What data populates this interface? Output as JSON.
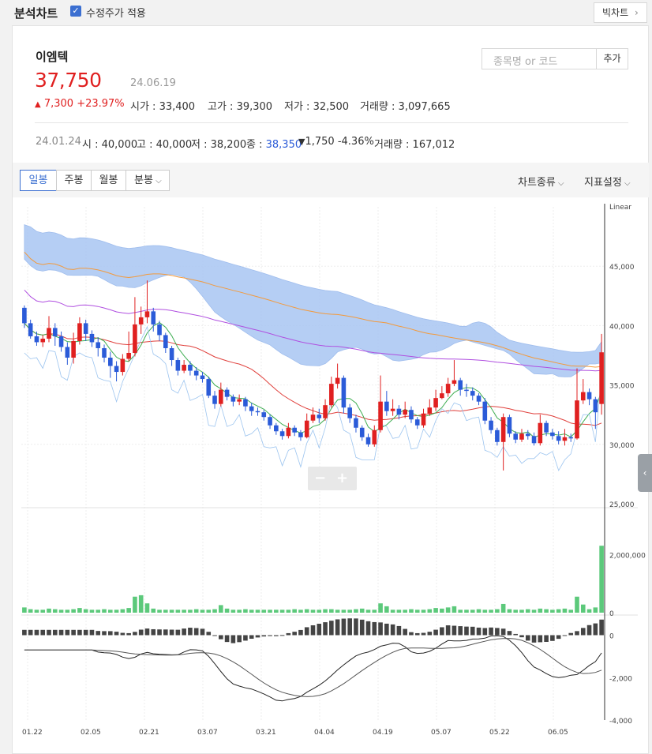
{
  "header": {
    "title": "분석차트",
    "adjusted_label": "수정주가 적용",
    "big_chart_label": "빅차트"
  },
  "stock": {
    "name": "이엠텍",
    "price": "37,750",
    "date": "24.06.19",
    "change": "7,300",
    "change_pct": "+23.97%",
    "open_label": "시가",
    "open": "33,400",
    "high_label": "고가",
    "high": "39,300",
    "low_label": "저가",
    "low": "32,500",
    "volume_label": "거래량",
    "volume": "3,097,665"
  },
  "prev": {
    "date": "24.01.24",
    "open_label": "시",
    "open": "40,000",
    "high_label": "고",
    "high": "40,000",
    "low_label": "저",
    "low": "38,200",
    "close_label": "종",
    "close": "38,350",
    "change": "1,750",
    "change_pct": "-4.36%",
    "volume_label": "거래량",
    "volume": "167,012"
  },
  "search": {
    "placeholder": "종목명 or 코드",
    "add_label": "추가"
  },
  "tabs": [
    {
      "label": "일봉",
      "active": true
    },
    {
      "label": "주봉"
    },
    {
      "label": "월봉"
    },
    {
      "label": "분봉"
    }
  ],
  "menus": {
    "chart_type": "차트종류",
    "indicator": "지표설정"
  },
  "colors": {
    "up": "#e02020",
    "down": "#2b5bd8",
    "volume": "#5cc97b",
    "cloud": "#a9c6f3"
  },
  "chart_data": {
    "type": "candlestick",
    "scale_label": "Linear",
    "x_ticks": [
      "01.22",
      "02.05",
      "02.21",
      "03.07",
      "03.21",
      "04.04",
      "04.19",
      "05.07",
      "05.22",
      "06.05"
    ],
    "price_axis": {
      "ticks": [
        "45,000",
        "40,000",
        "35,000",
        "30,000",
        "25,000"
      ],
      "ylim": [
        25000,
        50000
      ]
    },
    "volume_axis": {
      "ticks": [
        "2,000,000",
        "0"
      ],
      "ylim": [
        0,
        3500000
      ]
    },
    "macd_axis": {
      "ticks": [
        "0",
        "-2,000",
        "-4,000"
      ],
      "ylim": [
        -4000,
        800
      ]
    },
    "candles": [
      [
        41500,
        40200,
        41700,
        39800
      ],
      [
        40200,
        39100,
        40500,
        38900
      ],
      [
        39100,
        38600,
        39500,
        38300
      ],
      [
        38600,
        38900,
        39200,
        38200
      ],
      [
        38900,
        39800,
        40800,
        38600
      ],
      [
        39800,
        39100,
        40200,
        38300
      ],
      [
        39100,
        38200,
        39500,
        37800
      ],
      [
        38200,
        37300,
        38600,
        36700
      ],
      [
        37300,
        38700,
        39400,
        36800
      ],
      [
        38700,
        40200,
        40700,
        38400
      ],
      [
        40200,
        39300,
        40500,
        38700
      ],
      [
        39300,
        38600,
        39600,
        38200
      ],
      [
        38600,
        38100,
        39000,
        37400
      ],
      [
        38100,
        37300,
        38400,
        36900
      ],
      [
        37300,
        36600,
        37800,
        35600
      ],
      [
        36600,
        36100,
        37000,
        35300
      ],
      [
        36100,
        37200,
        37600,
        35800
      ],
      [
        37200,
        37700,
        39500,
        37000
      ],
      [
        37700,
        40100,
        42400,
        37400
      ],
      [
        40100,
        40700,
        41600,
        39300
      ],
      [
        40700,
        41200,
        43800,
        40200
      ],
      [
        41200,
        40100,
        41500,
        39500
      ],
      [
        40100,
        39200,
        40400,
        38700
      ],
      [
        39200,
        38100,
        39400,
        37700
      ],
      [
        38100,
        37100,
        38300,
        36600
      ],
      [
        37100,
        36200,
        37300,
        35800
      ],
      [
        36200,
        36700,
        37100,
        36000
      ],
      [
        36700,
        36200,
        37000,
        35800
      ],
      [
        36200,
        35800,
        36500,
        35400
      ],
      [
        35800,
        35500,
        36100,
        35200
      ],
      [
        35500,
        34100,
        35700,
        33900
      ],
      [
        34100,
        33400,
        34500,
        33000
      ],
      [
        33400,
        34600,
        35200,
        33200
      ],
      [
        34600,
        34000,
        34800,
        33700
      ],
      [
        34000,
        33600,
        34200,
        33200
      ],
      [
        33600,
        33800,
        34200,
        33300
      ],
      [
        33800,
        33200,
        34000,
        32800
      ],
      [
        33200,
        32800,
        33500,
        32400
      ],
      [
        32800,
        32700,
        33100,
        32400
      ],
      [
        32700,
        32300,
        32900,
        32000
      ],
      [
        32300,
        31600,
        32500,
        31300
      ],
      [
        31600,
        31100,
        31800,
        30800
      ],
      [
        31100,
        30700,
        31300,
        30400
      ],
      [
        30700,
        31400,
        31800,
        30500
      ],
      [
        31400,
        31000,
        31600,
        30700
      ],
      [
        31000,
        30600,
        31200,
        30300
      ],
      [
        30600,
        32000,
        32600,
        30500
      ],
      [
        32000,
        32500,
        33100,
        31800
      ],
      [
        32500,
        32200,
        33000,
        31800
      ],
      [
        32200,
        33300,
        33800,
        32000
      ],
      [
        33300,
        35100,
        35700,
        33100
      ],
      [
        35100,
        35600,
        36800,
        34700
      ],
      [
        35600,
        33100,
        35800,
        32600
      ],
      [
        33100,
        32200,
        33400,
        31800
      ],
      [
        32200,
        31400,
        32500,
        31000
      ],
      [
        31400,
        30600,
        31600,
        30300
      ],
      [
        30600,
        30000,
        30900,
        29800
      ],
      [
        30000,
        31200,
        31600,
        29800
      ],
      [
        31200,
        33600,
        35800,
        31000
      ],
      [
        33600,
        32800,
        34500,
        32400
      ],
      [
        32800,
        33000,
        33800,
        32400
      ],
      [
        33000,
        32500,
        33300,
        32100
      ],
      [
        32500,
        32900,
        33600,
        32200
      ],
      [
        32900,
        32100,
        33200,
        31800
      ],
      [
        32100,
        31600,
        32300,
        31300
      ],
      [
        31600,
        32600,
        33000,
        31400
      ],
      [
        32600,
        33100,
        33800,
        32400
      ],
      [
        33100,
        33900,
        34600,
        32800
      ],
      [
        33900,
        34300,
        34900,
        33800
      ],
      [
        34300,
        35100,
        35600,
        34000
      ],
      [
        35100,
        35400,
        37100,
        34900
      ],
      [
        35400,
        34600,
        35600,
        34100
      ],
      [
        34600,
        34500,
        35100,
        34000
      ],
      [
        34500,
        34100,
        34800,
        33700
      ],
      [
        34100,
        33600,
        34300,
        33300
      ],
      [
        33600,
        32000,
        33900,
        31700
      ],
      [
        32000,
        31200,
        32300,
        30900
      ],
      [
        31200,
        30200,
        31400,
        29900
      ],
      [
        30200,
        32300,
        32600,
        27800
      ],
      [
        32300,
        30900,
        32500,
        30600
      ],
      [
        30900,
        30400,
        31100,
        30100
      ],
      [
        30400,
        30900,
        31300,
        30200
      ],
      [
        30900,
        30700,
        31200,
        30400
      ],
      [
        30700,
        30100,
        31000,
        29900
      ],
      [
        30100,
        31800,
        32500,
        29900
      ],
      [
        31800,
        31000,
        32000,
        30700
      ],
      [
        31000,
        30700,
        31300,
        30400
      ],
      [
        30700,
        30300,
        31100,
        30000
      ],
      [
        30300,
        30600,
        31300,
        29900
      ],
      [
        30600,
        30500,
        30900,
        30200
      ],
      [
        30500,
        33700,
        36400,
        30400
      ],
      [
        33700,
        34400,
        35500,
        33400
      ],
      [
        34400,
        33800,
        34700,
        33300
      ],
      [
        33800,
        32700,
        34000,
        31300
      ],
      [
        33400,
        37750,
        39300,
        32500
      ]
    ],
    "volume": [
      0.18,
      0.12,
      0.1,
      0.1,
      0.14,
      0.12,
      0.1,
      0.1,
      0.12,
      0.16,
      0.12,
      0.1,
      0.1,
      0.12,
      0.1,
      0.1,
      0.12,
      0.16,
      0.55,
      0.6,
      0.32,
      0.14,
      0.1,
      0.1,
      0.1,
      0.1,
      0.1,
      0.1,
      0.12,
      0.1,
      0.1,
      0.12,
      0.26,
      0.14,
      0.1,
      0.1,
      0.12,
      0.1,
      0.1,
      0.1,
      0.1,
      0.1,
      0.1,
      0.1,
      0.12,
      0.1,
      0.12,
      0.1,
      0.1,
      0.12,
      0.12,
      0.1,
      0.1,
      0.1,
      0.12,
      0.14,
      0.1,
      0.1,
      0.32,
      0.22,
      0.1,
      0.1,
      0.1,
      0.12,
      0.1,
      0.1,
      0.12,
      0.16,
      0.14,
      0.18,
      0.22,
      0.1,
      0.1,
      0.1,
      0.12,
      0.1,
      0.1,
      0.12,
      0.3,
      0.12,
      0.1,
      0.1,
      0.12,
      0.1,
      0.14,
      0.12,
      0.1,
      0.12,
      0.14,
      0.1,
      0.55,
      0.28,
      0.12,
      0.18,
      2.3
    ]
  }
}
